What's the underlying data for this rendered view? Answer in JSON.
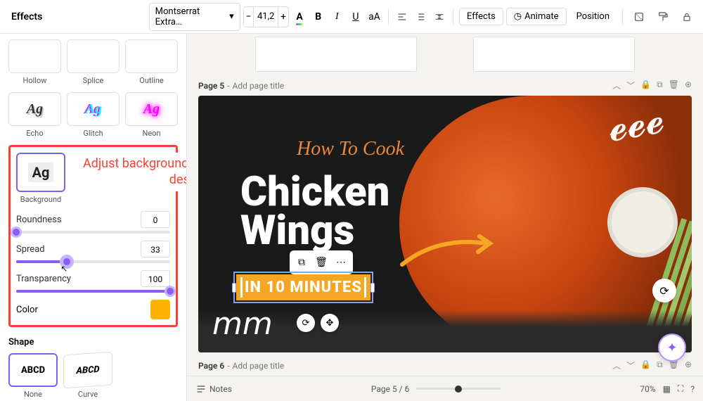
{
  "panel_title": "Effects",
  "toolbar": {
    "font_name": "Montserrat Extra…",
    "font_size": "41,2",
    "effects_btn": "Effects",
    "animate_btn": "Animate",
    "position_btn": "Position",
    "case_btn": "aA"
  },
  "effects": {
    "row1_labels": [
      "Hollow",
      "Splice",
      "Outline"
    ],
    "row2_labels": [
      "Echo",
      "Glitch",
      "Neon"
    ],
    "bg_tile": "Ag",
    "bg_label": "Background",
    "callout": "Adjust background settings to fit your design",
    "sliders": {
      "roundness": {
        "label": "Roundness",
        "value": "0",
        "pct": 0
      },
      "spread": {
        "label": "Spread",
        "value": "33",
        "pct": 33
      },
      "transparency": {
        "label": "Transparency",
        "value": "100",
        "pct": 100
      }
    },
    "color_label": "Color",
    "color_hex": "#ffb300"
  },
  "shape": {
    "title": "Shape",
    "tiles": [
      "ABCD",
      "ABCD"
    ],
    "labels": [
      "None",
      "Curve"
    ]
  },
  "pages": {
    "current_header_prefix": "Page 5",
    "next_header_prefix": "Page 6",
    "title_placeholder": "Add page title",
    "indicator": "Page 5 / 6"
  },
  "canvas": {
    "howto": "How To Cook",
    "main_line1": "Chicken",
    "main_line2": "Wings",
    "badge": "IN 10 MINUTES"
  },
  "bottom": {
    "notes": "Notes",
    "zoom": "70%"
  }
}
